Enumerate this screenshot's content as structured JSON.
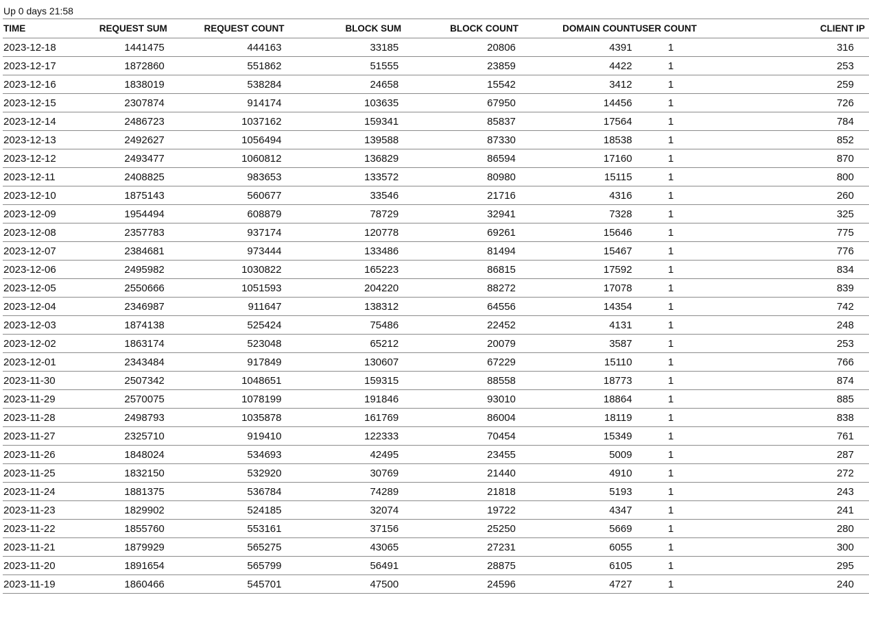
{
  "uptime": "Up 0 days 21:58",
  "table": {
    "headers": [
      "TIME",
      "REQUEST SUM",
      "REQUEST COUNT",
      "BLOCK SUM",
      "BLOCK COUNT",
      "DOMAIN COUNT",
      "USER COUNT",
      "CLIENT IP"
    ],
    "rows": [
      [
        "2023-12-18",
        "1441475",
        "444163",
        "33185",
        "20806",
        "4391",
        "1",
        "316"
      ],
      [
        "2023-12-17",
        "1872860",
        "551862",
        "51555",
        "23859",
        "4422",
        "1",
        "253"
      ],
      [
        "2023-12-16",
        "1838019",
        "538284",
        "24658",
        "15542",
        "3412",
        "1",
        "259"
      ],
      [
        "2023-12-15",
        "2307874",
        "914174",
        "103635",
        "67950",
        "14456",
        "1",
        "726"
      ],
      [
        "2023-12-14",
        "2486723",
        "1037162",
        "159341",
        "85837",
        "17564",
        "1",
        "784"
      ],
      [
        "2023-12-13",
        "2492627",
        "1056494",
        "139588",
        "87330",
        "18538",
        "1",
        "852"
      ],
      [
        "2023-12-12",
        "2493477",
        "1060812",
        "136829",
        "86594",
        "17160",
        "1",
        "870"
      ],
      [
        "2023-12-11",
        "2408825",
        "983653",
        "133572",
        "80980",
        "15115",
        "1",
        "800"
      ],
      [
        "2023-12-10",
        "1875143",
        "560677",
        "33546",
        "21716",
        "4316",
        "1",
        "260"
      ],
      [
        "2023-12-09",
        "1954494",
        "608879",
        "78729",
        "32941",
        "7328",
        "1",
        "325"
      ],
      [
        "2023-12-08",
        "2357783",
        "937174",
        "120778",
        "69261",
        "15646",
        "1",
        "775"
      ],
      [
        "2023-12-07",
        "2384681",
        "973444",
        "133486",
        "81494",
        "15467",
        "1",
        "776"
      ],
      [
        "2023-12-06",
        "2495982",
        "1030822",
        "165223",
        "86815",
        "17592",
        "1",
        "834"
      ],
      [
        "2023-12-05",
        "2550666",
        "1051593",
        "204220",
        "88272",
        "17078",
        "1",
        "839"
      ],
      [
        "2023-12-04",
        "2346987",
        "911647",
        "138312",
        "64556",
        "14354",
        "1",
        "742"
      ],
      [
        "2023-12-03",
        "1874138",
        "525424",
        "75486",
        "22452",
        "4131",
        "1",
        "248"
      ],
      [
        "2023-12-02",
        "1863174",
        "523048",
        "65212",
        "20079",
        "3587",
        "1",
        "253"
      ],
      [
        "2023-12-01",
        "2343484",
        "917849",
        "130607",
        "67229",
        "15110",
        "1",
        "766"
      ],
      [
        "2023-11-30",
        "2507342",
        "1048651",
        "159315",
        "88558",
        "18773",
        "1",
        "874"
      ],
      [
        "2023-11-29",
        "2570075",
        "1078199",
        "191846",
        "93010",
        "18864",
        "1",
        "885"
      ],
      [
        "2023-11-28",
        "2498793",
        "1035878",
        "161769",
        "86004",
        "18119",
        "1",
        "838"
      ],
      [
        "2023-11-27",
        "2325710",
        "919410",
        "122333",
        "70454",
        "15349",
        "1",
        "761"
      ],
      [
        "2023-11-26",
        "1848024",
        "534693",
        "42495",
        "23455",
        "5009",
        "1",
        "287"
      ],
      [
        "2023-11-25",
        "1832150",
        "532920",
        "30769",
        "21440",
        "4910",
        "1",
        "272"
      ],
      [
        "2023-11-24",
        "1881375",
        "536784",
        "74289",
        "21818",
        "5193",
        "1",
        "243"
      ],
      [
        "2023-11-23",
        "1829902",
        "524185",
        "32074",
        "19722",
        "4347",
        "1",
        "241"
      ],
      [
        "2023-11-22",
        "1855760",
        "553161",
        "37156",
        "25250",
        "5669",
        "1",
        "280"
      ],
      [
        "2023-11-21",
        "1879929",
        "565275",
        "43065",
        "27231",
        "6055",
        "1",
        "300"
      ],
      [
        "2023-11-20",
        "1891654",
        "565799",
        "56491",
        "28875",
        "6105",
        "1",
        "295"
      ],
      [
        "2023-11-19",
        "1860466",
        "545701",
        "47500",
        "24596",
        "4727",
        "1",
        "240"
      ]
    ]
  }
}
